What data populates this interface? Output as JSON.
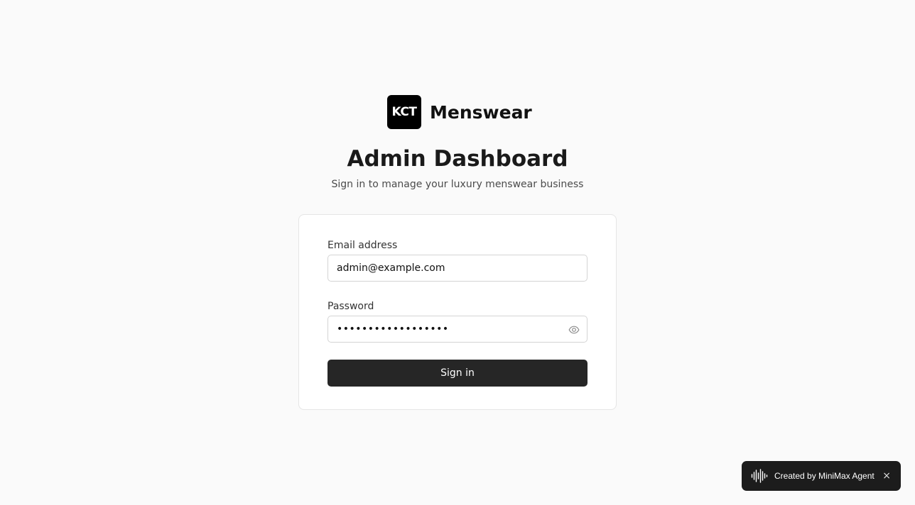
{
  "brand": {
    "logo_text": "KCT",
    "name": "Menswear"
  },
  "header": {
    "title": "Admin Dashboard",
    "subtitle": "Sign in to manage your luxury menswear business"
  },
  "form": {
    "email": {
      "label": "Email address",
      "value": "admin@example.com"
    },
    "password": {
      "label": "Password",
      "masked_value": "••••••••••••••••••",
      "toggle_icon": "eye-icon"
    },
    "submit_label": "Sign in"
  },
  "toast": {
    "icon": "soundwave-icon",
    "text": "Created by MiniMax Agent",
    "close_label": "×"
  },
  "colors": {
    "background": "#fafafa",
    "logo_bg": "#000000",
    "button_bg": "#262626",
    "toast_bg": "#1c1c1c"
  }
}
